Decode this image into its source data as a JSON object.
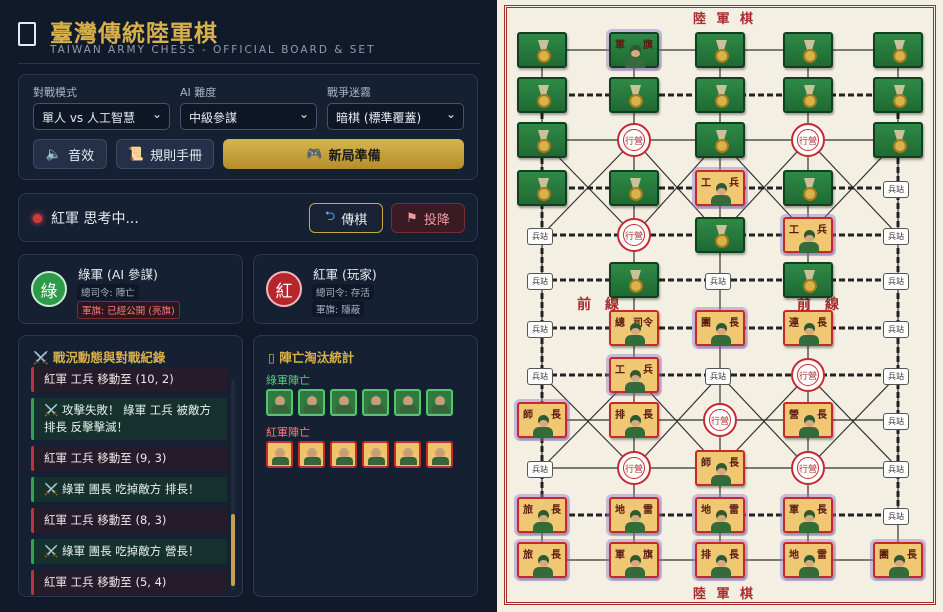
{
  "header": {
    "title": "臺灣傳統陸軍棋",
    "subtitle": "TAIWAN ARMY CHESS - OFFICIAL BOARD & SET",
    "logo_icon": "phone-icon"
  },
  "settings": {
    "mode_label": "對戰模式",
    "mode_value": "單人 vs 人工智慧",
    "ai_label": "AI 難度",
    "ai_value": "中級參謀",
    "fog_label": "戰爭迷霧",
    "fog_value": "暗棋 (標準覆蓋)",
    "sound_label": "音效",
    "rules_label": "規則手冊",
    "newgame_label": "新局準備"
  },
  "status": {
    "text": "紅軍 思考中...",
    "pass_label": "傳棋",
    "surrender_label": "投降"
  },
  "players": {
    "green": {
      "disc": "綠",
      "name": "綠軍 (AI 參謀)",
      "info1": "總司令: 陣亡",
      "info2": "軍旗: 已經公開 (亮旗)"
    },
    "red": {
      "disc": "紅",
      "name": "紅軍 (玩家)",
      "info1": "總司令: 存活",
      "info2": "軍旗: 隱蔽"
    }
  },
  "log": {
    "title": "戰況動態與對戰紀錄",
    "items": [
      {
        "side": "red",
        "text": "紅軍 工兵 移動至 (10, 2)"
      },
      {
        "side": "green",
        "text": "⚔️ 攻擊失敗！ 綠軍 工兵 被敵方 排長 反擊擊滅！"
      },
      {
        "side": "red",
        "text": "紅軍 工兵 移動至 (9, 3)"
      },
      {
        "side": "green",
        "text": "⚔️ 綠軍 團長 吃掉敵方 排長！"
      },
      {
        "side": "red",
        "text": "紅軍 工兵 移動至 (8, 3)"
      },
      {
        "side": "green",
        "text": "⚔️ 綠軍 團長 吃掉敵方 營長！"
      },
      {
        "side": "red",
        "text": "紅軍 工兵 移動至 (5, 4)"
      }
    ]
  },
  "casualties": {
    "title": "陣亡淘汰統計",
    "green_label": "綠軍陣亡",
    "red_label": "紅軍陣亡",
    "green_count": 6,
    "red_count": 6
  },
  "board": {
    "title_top": "陸 軍 棋",
    "title_bottom": "陸 軍 棋",
    "front_left": "前　線",
    "front_right": "前　線",
    "station_label": "兵站",
    "camp_label": "行營",
    "pieces": {
      "g_flag": [
        "軍",
        "旗"
      ],
      "r_eng_a": [
        "工",
        "兵"
      ],
      "r_eng_b": [
        "工",
        "兵"
      ],
      "r_commander": [
        "總",
        "司令"
      ],
      "r_regiment_a": [
        "團",
        "長"
      ],
      "r_company": [
        "連",
        "長"
      ],
      "r_eng_c": [
        "工",
        "兵"
      ],
      "r_division": [
        "師",
        "長"
      ],
      "r_platoon": [
        "排",
        "長"
      ],
      "r_battalion": [
        "營",
        "長"
      ],
      "r_division_b": [
        "師",
        "長"
      ],
      "r_brigade": [
        "旅",
        "長"
      ],
      "r_mine_a": [
        "地",
        "雷"
      ],
      "r_mine_b": [
        "地",
        "雷"
      ],
      "r_army": [
        "軍",
        "長"
      ],
      "r_brigade_b": [
        "旅",
        "長"
      ],
      "r_flag": [
        "軍",
        "旗"
      ],
      "r_platoon_b": [
        "排",
        "長"
      ],
      "r_mine_c": [
        "地",
        "雷"
      ],
      "r_regiment_b": [
        "團",
        "長"
      ]
    }
  }
}
